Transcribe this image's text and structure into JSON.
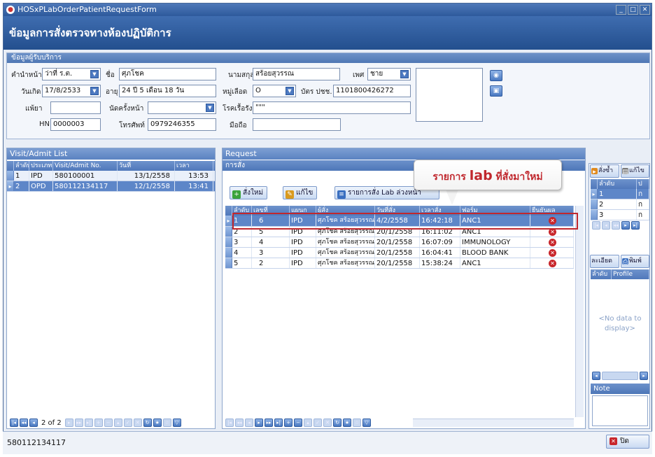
{
  "window": {
    "title": "HOSxPLabOrderPatientRequestForm",
    "header": "ข้อมูลการสั่งตรวจทางห้องปฏิบัติการ"
  },
  "patient_group": {
    "title": "ข้อมูลผู้รับบริการ",
    "prefix_label": "คำนำหน้า",
    "prefix_value": "ว่าที่ ร.ต.",
    "name_label": "ชื่อ",
    "name_value": "ศุภโชค",
    "surname_label": "นามสกุล",
    "surname_value": "สร้อยสุวรรณ",
    "sex_label": "เพศ",
    "sex_value": "ชาย",
    "dob_label": "วันเกิด",
    "dob_value": "17/8/2533",
    "age_label": "อายุ",
    "age_value": "24 ปี 5 เดือน 18 วัน",
    "blood_label": "หมู่เลือด",
    "blood_value": "O",
    "cid_label": "บัตร ปชช.",
    "cid_value": "1101800426272",
    "allergy_label": "แพ้ยา",
    "allergy_value": "",
    "appt_label": "นัดครั้งหน้า",
    "appt_value": "",
    "chronic_label": "โรคเรื้อรัง",
    "chronic_value": "\"\"\"",
    "hn_label": "HN",
    "hn_value": "0000003",
    "phone_label": "โทรศัพท์",
    "phone_value": "0979246355",
    "mobile_label": "มือถือ",
    "mobile_value": ""
  },
  "visit_panel": {
    "title": "Visit/Admit List",
    "columns": [
      "ลำดับ",
      "ประเภท",
      "Visit/Admit No.",
      "วันที่",
      "เวลา"
    ],
    "rows": [
      {
        "no": "1",
        "type": "IPD",
        "vn": "580100001",
        "date": "13/1/2558",
        "time": "13:53"
      },
      {
        "no": "2",
        "type": "OPD",
        "vn": "580112134117",
        "date": "12/1/2558",
        "time": "13:41"
      }
    ],
    "nav_text": "2 of 2"
  },
  "request_panel": {
    "title": "Request",
    "sub_title": "การสั่ง",
    "btn_new": "สั่งใหม่",
    "btn_edit": "แก้ไข",
    "btn_lab": "รายการสั่ง Lab ล่วงหน้า",
    "columns": [
      "ลำดับ",
      "เลขที่",
      "แผนก",
      "ผู้สั่ง",
      "วันที่สั่ง",
      "เวลาสั่ง",
      "ฟอร์ม",
      "ยืนยันผล"
    ],
    "rows": [
      {
        "no": "1",
        "num": "6",
        "dept": "IPD",
        "by": "ศุภโชค สร้อยสุวรรณ",
        "date": "4/2/2558",
        "time": "16:42:18",
        "form": "ANC1"
      },
      {
        "no": "2",
        "num": "5",
        "dept": "IPD",
        "by": "ศุภโชค สร้อยสุวรรณ",
        "date": "20/1/2558",
        "time": "16:11:02",
        "form": "ANC1"
      },
      {
        "no": "3",
        "num": "4",
        "dept": "IPD",
        "by": "ศุภโชค สร้อยสุวรรณ",
        "date": "20/1/2558",
        "time": "16:07:09",
        "form": "IMMUNOLOGY"
      },
      {
        "no": "4",
        "num": "3",
        "dept": "IPD",
        "by": "ศุภโชค สร้อยสุวรรณ",
        "date": "20/1/2558",
        "time": "16:04:41",
        "form": "BLOOD BANK"
      },
      {
        "no": "5",
        "num": "2",
        "dept": "IPD",
        "by": "ศุภโชค สร้อยสุวรรณ",
        "date": "20/1/2558",
        "time": "15:38:24",
        "form": "ANC1"
      }
    ]
  },
  "callout": {
    "prefix": "รายการ ",
    "word": "lab",
    "suffix": " ที่สั่งมาใหม่"
  },
  "right_panel": {
    "btn_order": "สั่งซ้ำ",
    "btn_edit": "แก้ไข",
    "col_no": "ลำดับ",
    "col_p": "ป",
    "rows": [
      {
        "no": "1",
        "v": "ก"
      },
      {
        "no": "2",
        "v": "ก"
      },
      {
        "no": "3",
        "v": "ก"
      }
    ],
    "btn_detail": "ละเอียด",
    "btn_print": "พิมพ์",
    "col_profile": "Profile",
    "no_data": "<No data to display>",
    "note_label": "Note"
  },
  "status": {
    "vn": "580112134117",
    "close_label": "ปิด"
  },
  "colors": {
    "accent": "#2e5a9c",
    "highlight": "#c0272d",
    "selected_row": "#5d86c8"
  }
}
